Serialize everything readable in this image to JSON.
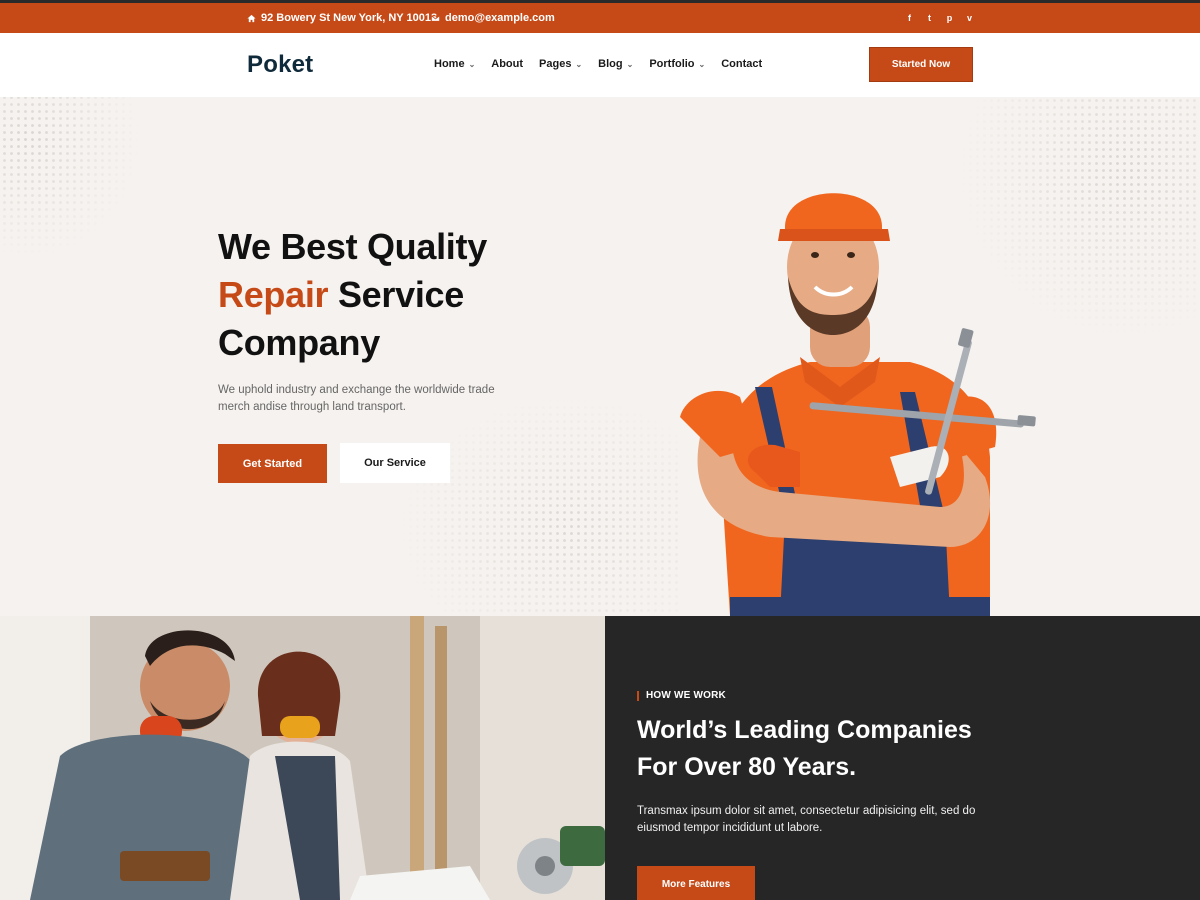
{
  "topbar": {
    "address": "92 Bowery St New York, NY 10013",
    "email": "demo@example.com",
    "social": [
      {
        "icon": "facebook-icon",
        "glyph": "f"
      },
      {
        "icon": "twitter-icon",
        "glyph": "t"
      },
      {
        "icon": "pinterest-icon",
        "glyph": "p"
      },
      {
        "icon": "vimeo-icon",
        "glyph": "v"
      }
    ]
  },
  "header": {
    "logo": "Poket",
    "nav": [
      {
        "label": "Home",
        "dropdown": true
      },
      {
        "label": "About",
        "dropdown": false
      },
      {
        "label": "Pages",
        "dropdown": true
      },
      {
        "label": "Blog",
        "dropdown": true
      },
      {
        "label": "Portfolio",
        "dropdown": true
      },
      {
        "label": "Contact",
        "dropdown": false
      }
    ],
    "cta": "Started Now"
  },
  "hero": {
    "title_line1": "We Best Quality",
    "title_accent": "Repair",
    "title_line2_rest": " Service",
    "title_line3": "Company",
    "description": "We uphold industry and exchange the worldwide trade merch andise through land transport.",
    "primary_button": "Get Started",
    "secondary_button": "Our Service"
  },
  "how_we_work": {
    "eyebrow": "HOW WE WORK",
    "title": "World’s Leading Companies For Over 80 Years.",
    "description": "Transmax ipsum dolor sit amet, consectetur adipisicing elit, sed do eiusmod tempor incididunt ut labore.",
    "button": "More Features"
  },
  "colors": {
    "accent": "#c64a17",
    "dark": "#262626",
    "hero_bg": "#f6f2ef"
  }
}
